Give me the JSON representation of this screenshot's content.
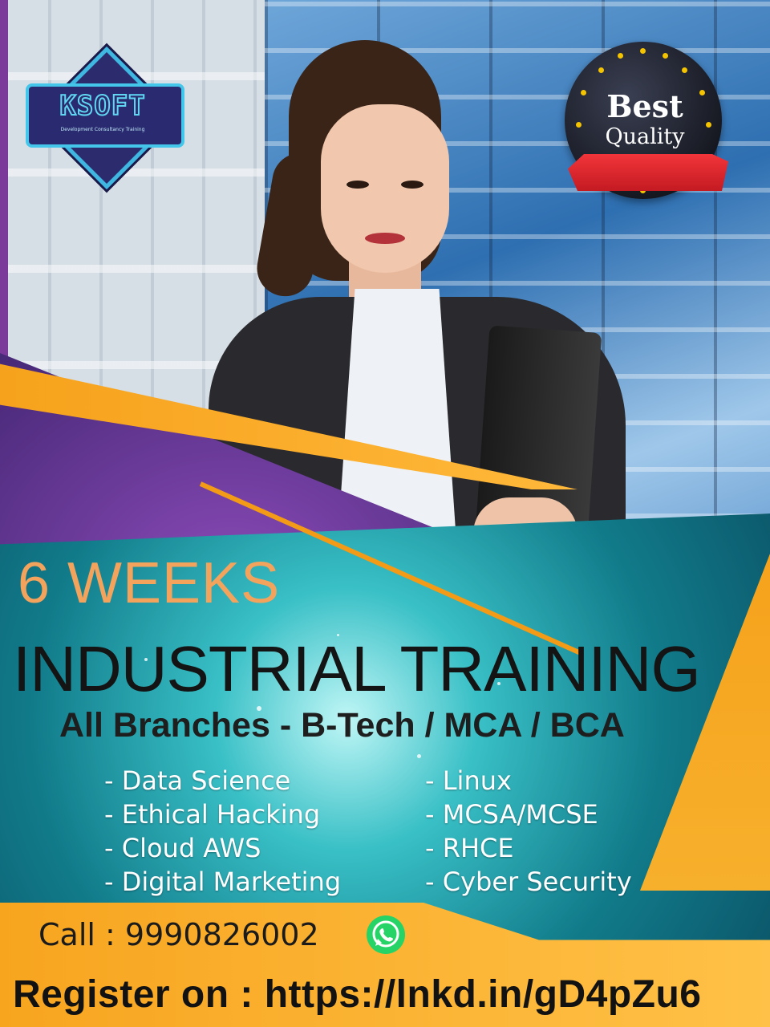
{
  "logo": {
    "name": "KSOFT",
    "tagline": "Development Consultancy Training"
  },
  "badge": {
    "line1": "Best",
    "line2": "Quality"
  },
  "headline": {
    "duration": "6 WEEKS",
    "title": "INDUSTRIAL TRAINING",
    "subtitle": "All Branches - B-Tech / MCA / BCA"
  },
  "courses": {
    "left": [
      "- Data Science",
      "- Ethical Hacking",
      "- Cloud AWS",
      "- Digital Marketing"
    ],
    "right": [
      "- Linux",
      "- MCSA/MCSE",
      "- RHCE",
      "- Cyber Security"
    ]
  },
  "contact": {
    "call": "Call : 9990826002",
    "register": "Register on : https://lnkd.in/gD4pZu6",
    "whatsapp_icon": "whatsapp-icon"
  },
  "colors": {
    "orange": "#f6a21c",
    "teal": "#117b8a",
    "purple": "#4a2a7a",
    "weeks_text": "#f4a35d",
    "whatsapp": "#25d366"
  }
}
